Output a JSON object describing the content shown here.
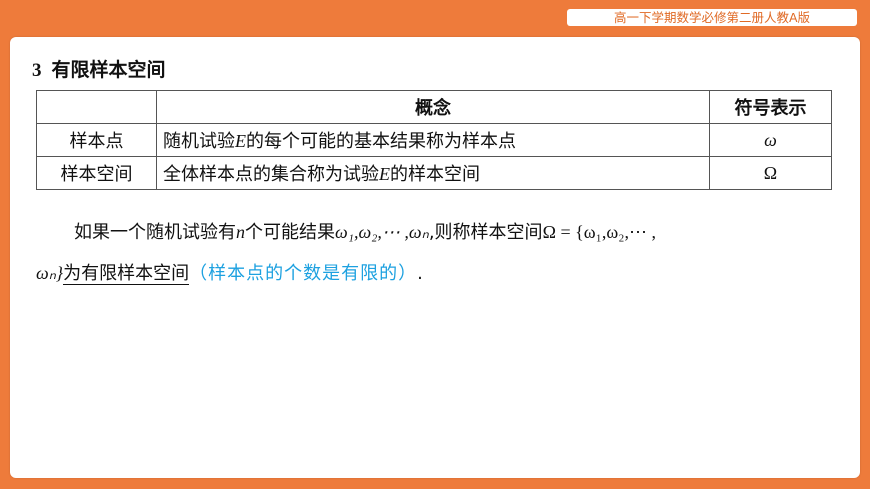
{
  "header": {
    "course_label": "高一下学期数学必修第二册人教A版"
  },
  "section": {
    "number": "3",
    "title": "有限样本空间"
  },
  "table": {
    "headers": [
      "",
      "概念",
      "符号表示"
    ],
    "rows": [
      {
        "term": "样本点",
        "concept_a": "随机试验",
        "concept_var": "E",
        "concept_b": "的每个可能的基本结果称为样本点",
        "symbol": "ω"
      },
      {
        "term": "样本空间",
        "concept_a": "全体样本点的集合称为试验",
        "concept_var": "E",
        "concept_b": "的样本空间",
        "symbol": "Ω"
      }
    ]
  },
  "paragraph": {
    "p1": "如果一个随机试验有",
    "var_n": "n",
    "p2": "个可能结果",
    "outcomes_a": "ω₁,ω₂,⋯ ,ωₙ",
    "p3": ",则称样本空间",
    "set_expr": "Ω = {ω₁,ω₂,⋯ ,",
    "set_end": "ωₙ}",
    "p4": "为有限样本空间",
    "note": "（样本点的个数是有限的）",
    "period": "."
  }
}
